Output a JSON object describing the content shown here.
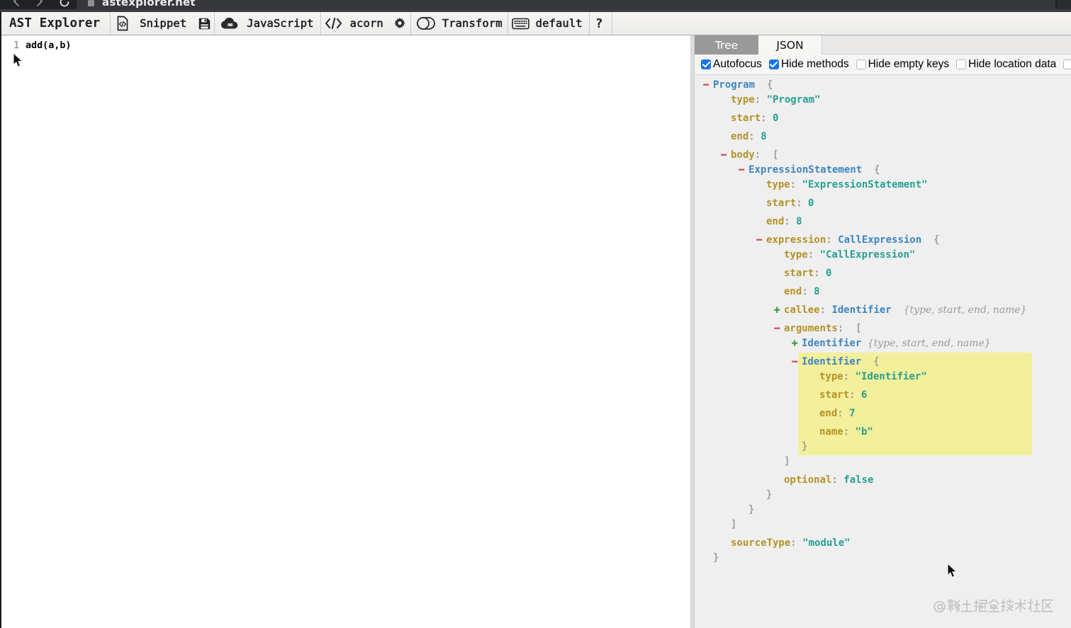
{
  "browser": {
    "tab_title": "astexplorer.net",
    "back_icon": "chevron-left",
    "forward_icon": "chevron-right",
    "reload_icon": "reload-circle"
  },
  "toolbar": {
    "title": "AST Explorer",
    "snippet": {
      "label": "Snippet",
      "left_icon": "file-code-icon",
      "right_icon": "save-floppy-icon"
    },
    "category": {
      "label": "JavaScript",
      "icon": "cloud-icon"
    },
    "parser": {
      "label": "acorn",
      "left_icon": "code-brackets-icon",
      "right_icon": "gear-icon"
    },
    "transform": {
      "label": "Transform",
      "icon": "toggle-off-icon"
    },
    "keymap": {
      "label": "default",
      "icon": "keyboard-icon"
    },
    "help": {
      "label": "?"
    }
  },
  "editor": {
    "line_number": "1",
    "code": "add(a,b)"
  },
  "right_panel": {
    "tabs": [
      {
        "label": "Tree",
        "active": true
      },
      {
        "label": "JSON",
        "active": false
      }
    ],
    "options": [
      {
        "label": "Autofocus",
        "checked": true
      },
      {
        "label": "Hide methods",
        "checked": true
      },
      {
        "label": "Hide empty keys",
        "checked": false
      },
      {
        "label": "Hide location data",
        "checked": false
      },
      {
        "label": "",
        "checked": false,
        "clipped": true
      }
    ],
    "watermark": "@稀土掘金技术社区"
  },
  "tree": {
    "highlight_color": "#f4ef9b",
    "colors": {
      "key": "#b49226",
      "node": "#3e85c0",
      "value": "#24a092",
      "punct": "#9a9a9a",
      "collapse": "#d6424e",
      "expand": "#3f9c3f"
    },
    "lines": [
      {
        "indent": 0,
        "toggle": "-",
        "tight": true,
        "parts": [
          [
            "n",
            "Program"
          ],
          [
            "p",
            "  {"
          ]
        ]
      },
      {
        "indent": 1,
        "toggle": "",
        "tight": true,
        "parts": [
          [
            "k",
            "type"
          ],
          [
            "p",
            ": "
          ],
          [
            "v",
            "\"Program\""
          ]
        ]
      },
      {
        "indent": 1,
        "toggle": "",
        "tight": false,
        "parts": [
          [
            "k",
            "start"
          ],
          [
            "p",
            ": "
          ],
          [
            "v",
            "0"
          ]
        ]
      },
      {
        "indent": 1,
        "toggle": "",
        "tight": false,
        "parts": [
          [
            "k",
            "end"
          ],
          [
            "p",
            ": "
          ],
          [
            "v",
            "8"
          ]
        ]
      },
      {
        "indent": 1,
        "toggle": "-",
        "tight": false,
        "parts": [
          [
            "k",
            "body"
          ],
          [
            "p",
            ":  ["
          ]
        ]
      },
      {
        "indent": 2,
        "toggle": "-",
        "tight": true,
        "parts": [
          [
            "n",
            "ExpressionStatement"
          ],
          [
            "p",
            "  {"
          ]
        ]
      },
      {
        "indent": 3,
        "toggle": "",
        "tight": true,
        "parts": [
          [
            "k",
            "type"
          ],
          [
            "p",
            ": "
          ],
          [
            "v",
            "\"ExpressionStatement\""
          ]
        ]
      },
      {
        "indent": 3,
        "toggle": "",
        "tight": false,
        "parts": [
          [
            "k",
            "start"
          ],
          [
            "p",
            ": "
          ],
          [
            "v",
            "0"
          ]
        ]
      },
      {
        "indent": 3,
        "toggle": "",
        "tight": false,
        "parts": [
          [
            "k",
            "end"
          ],
          [
            "p",
            ": "
          ],
          [
            "v",
            "8"
          ]
        ]
      },
      {
        "indent": 3,
        "toggle": "-",
        "tight": false,
        "parts": [
          [
            "k",
            "expression"
          ],
          [
            "p",
            ": "
          ],
          [
            "n",
            "CallExpression"
          ],
          [
            "p",
            "  {"
          ]
        ]
      },
      {
        "indent": 4,
        "toggle": "",
        "tight": true,
        "parts": [
          [
            "k",
            "type"
          ],
          [
            "p",
            ": "
          ],
          [
            "v",
            "\"CallExpression\""
          ]
        ]
      },
      {
        "indent": 4,
        "toggle": "",
        "tight": false,
        "parts": [
          [
            "k",
            "start"
          ],
          [
            "p",
            ": "
          ],
          [
            "v",
            "0"
          ]
        ]
      },
      {
        "indent": 4,
        "toggle": "",
        "tight": false,
        "parts": [
          [
            "k",
            "end"
          ],
          [
            "p",
            ": "
          ],
          [
            "v",
            "8"
          ]
        ]
      },
      {
        "indent": 4,
        "toggle": "+",
        "tight": false,
        "parts": [
          [
            "k",
            "callee"
          ],
          [
            "p",
            ": "
          ],
          [
            "n",
            "Identifier"
          ],
          [
            "p",
            "  "
          ],
          [
            "i",
            "{type, start, end, name}"
          ]
        ]
      },
      {
        "indent": 4,
        "toggle": "-",
        "tight": false,
        "parts": [
          [
            "k",
            "arguments"
          ],
          [
            "p",
            ":  ["
          ]
        ]
      },
      {
        "indent": 5,
        "toggle": "+",
        "tight": true,
        "parts": [
          [
            "n",
            "Identifier"
          ],
          [
            "p",
            " "
          ],
          [
            "i",
            "{type, start, end, name}"
          ]
        ]
      },
      {
        "indent": 5,
        "toggle": "-",
        "tight": true,
        "hl": true,
        "parts": [
          [
            "n",
            "Identifier"
          ],
          [
            "p",
            "  {"
          ]
        ]
      },
      {
        "indent": 6,
        "toggle": "",
        "tight": true,
        "hl": true,
        "parts": [
          [
            "k",
            "type"
          ],
          [
            "p",
            ": "
          ],
          [
            "v",
            "\"Identifier\""
          ]
        ]
      },
      {
        "indent": 6,
        "toggle": "",
        "tight": false,
        "hl": true,
        "parts": [
          [
            "k",
            "start"
          ],
          [
            "p",
            ": "
          ],
          [
            "v",
            "6"
          ]
        ]
      },
      {
        "indent": 6,
        "toggle": "",
        "tight": false,
        "hl": true,
        "parts": [
          [
            "k",
            "end"
          ],
          [
            "p",
            ": "
          ],
          [
            "v",
            "7"
          ]
        ]
      },
      {
        "indent": 6,
        "toggle": "",
        "tight": false,
        "hl": true,
        "parts": [
          [
            "k",
            "name"
          ],
          [
            "p",
            ": "
          ],
          [
            "v",
            "\"b\""
          ]
        ]
      },
      {
        "indent": 5,
        "toggle": "",
        "tight": true,
        "hl": true,
        "parts": [
          [
            "p",
            "}"
          ]
        ]
      },
      {
        "indent": 4,
        "toggle": "",
        "tight": true,
        "parts": [
          [
            "p",
            "]"
          ]
        ]
      },
      {
        "indent": 4,
        "toggle": "",
        "tight": false,
        "parts": [
          [
            "k",
            "optional"
          ],
          [
            "p",
            ": "
          ],
          [
            "v",
            "false"
          ]
        ]
      },
      {
        "indent": 3,
        "toggle": "",
        "tight": true,
        "parts": [
          [
            "p",
            "}"
          ]
        ]
      },
      {
        "indent": 2,
        "toggle": "",
        "tight": true,
        "parts": [
          [
            "p",
            "}"
          ]
        ]
      },
      {
        "indent": 1,
        "toggle": "",
        "tight": true,
        "parts": [
          [
            "p",
            "]"
          ]
        ]
      },
      {
        "indent": 1,
        "toggle": "",
        "tight": false,
        "parts": [
          [
            "k",
            "sourceType"
          ],
          [
            "p",
            ": "
          ],
          [
            "v",
            "\"module\""
          ]
        ]
      },
      {
        "indent": 0,
        "toggle": "",
        "tight": true,
        "parts": [
          [
            "p",
            "}"
          ]
        ]
      }
    ]
  }
}
